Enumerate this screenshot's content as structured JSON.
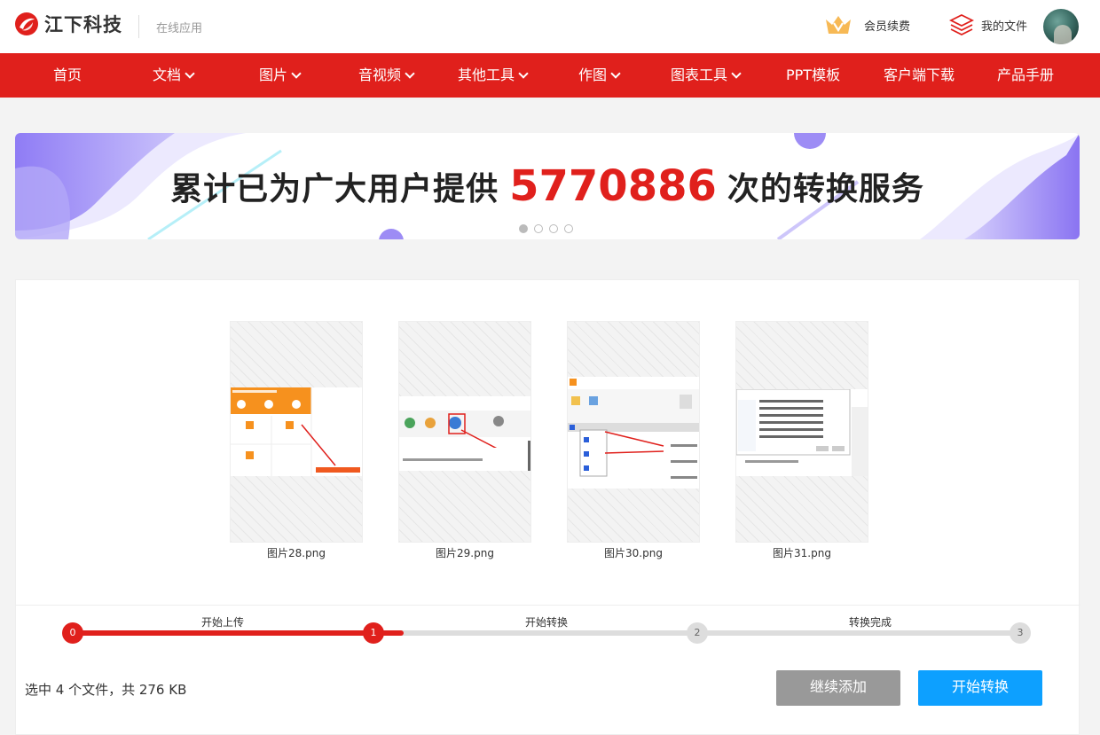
{
  "header": {
    "brand": "江下科技",
    "subtitle": "在线应用",
    "vip_label": "会员续费",
    "files_label": "我的文件"
  },
  "nav": {
    "items": [
      {
        "label": "首页",
        "dropdown": false
      },
      {
        "label": "文档",
        "dropdown": true
      },
      {
        "label": "图片",
        "dropdown": true
      },
      {
        "label": "音视频",
        "dropdown": true
      },
      {
        "label": "其他工具",
        "dropdown": true
      },
      {
        "label": "作图",
        "dropdown": true
      },
      {
        "label": "图表工具",
        "dropdown": true
      },
      {
        "label": "PPT模板",
        "dropdown": false
      },
      {
        "label": "客户端下载",
        "dropdown": false
      },
      {
        "label": "产品手册",
        "dropdown": false
      }
    ]
  },
  "banner": {
    "text_before": "累计已为广大用户提供",
    "count": "5770886",
    "text_after": "次的转换服务",
    "slides": 4,
    "active_slide": 0
  },
  "files": [
    {
      "name": "图片28.png"
    },
    {
      "name": "图片29.png"
    },
    {
      "name": "图片30.png"
    },
    {
      "name": "图片31.png"
    }
  ],
  "steps": {
    "labels": [
      "开始上传",
      "开始转换",
      "转换完成"
    ],
    "nodes": [
      "0",
      "1",
      "2",
      "3"
    ],
    "completed_through": 1
  },
  "summary": "选中 4 个文件，共 276 KB",
  "buttons": {
    "continue_add": "继续添加",
    "start_convert": "开始转换"
  },
  "colors": {
    "brand_red": "#e0201c",
    "primary_blue": "#0da0ff",
    "neutral_gray": "#999999"
  }
}
